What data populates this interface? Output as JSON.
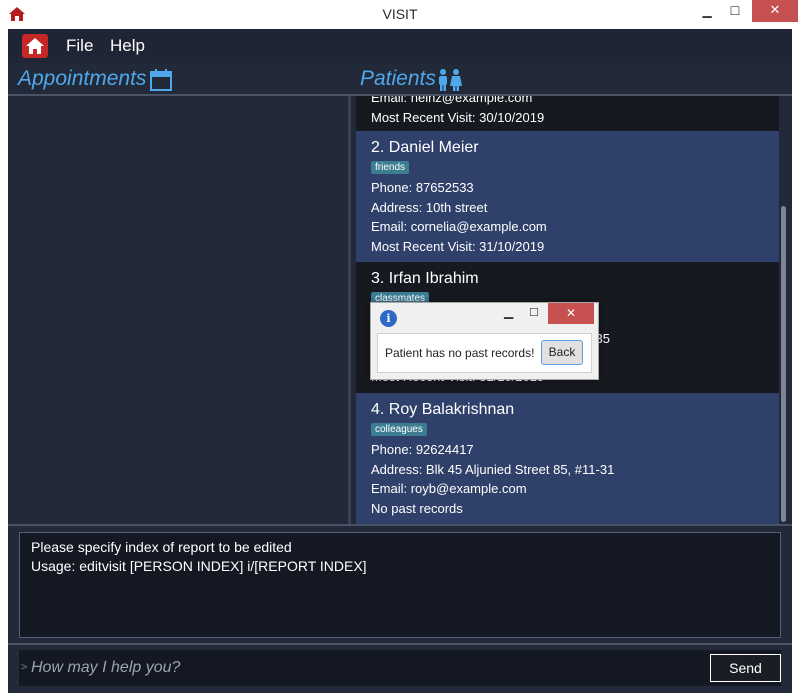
{
  "window": {
    "title": "VISIT",
    "minimize": "▁",
    "maximize": "☐",
    "close": "✕"
  },
  "menu": {
    "file": "File",
    "help": "Help"
  },
  "headers": {
    "appointments": "Appointments",
    "patients": "Patients"
  },
  "patients": [
    {
      "email": "Email: heinz@example.com",
      "recent_visit": "Most Recent Visit: 30/10/2019"
    },
    {
      "name": "2.  Daniel Meier",
      "tag": "friends",
      "phone": "Phone: 87652533",
      "address": "Address: 10th street",
      "email": "Email: cornelia@example.com",
      "recent_visit": "Most Recent Visit: 31/10/2019"
    },
    {
      "name": "3.  Irfan Ibrahim",
      "tag": "classmates",
      "address_tail": "7-35",
      "recent_visit": "Most Recent Visit: 31/10/2019"
    },
    {
      "name": "4.  Roy Balakrishnan",
      "tag": "colleagues",
      "phone": "Phone: 92624417",
      "address": "Address: Blk 45 Aljunied Street 85, #11-31",
      "email": "Email: royb@example.com",
      "recent_visit": "No past records"
    }
  ],
  "dialog": {
    "message": "Patient has no past records!",
    "back_button": "Back",
    "info_glyph": "i",
    "minimize": "▁",
    "maximize": "☐",
    "close": "✕"
  },
  "result": {
    "line1": "Please specify index of report to be edited",
    "line2": "Usage: editvisit [PERSON INDEX] i/[REPORT INDEX]"
  },
  "command": {
    "prompt": ">",
    "placeholder": "How may I help you?",
    "value": "",
    "send_label": "Send"
  },
  "colors": {
    "accent": "#4fa8ea",
    "card_dark": "#16191f",
    "card_blue": "#2f416a",
    "tag": "#3d7d92",
    "close_red": "#c75050"
  },
  "icons": {
    "app": "home-icon",
    "appointments": "calendar-icon",
    "patients": "people-icon",
    "dialog": "info-icon"
  }
}
